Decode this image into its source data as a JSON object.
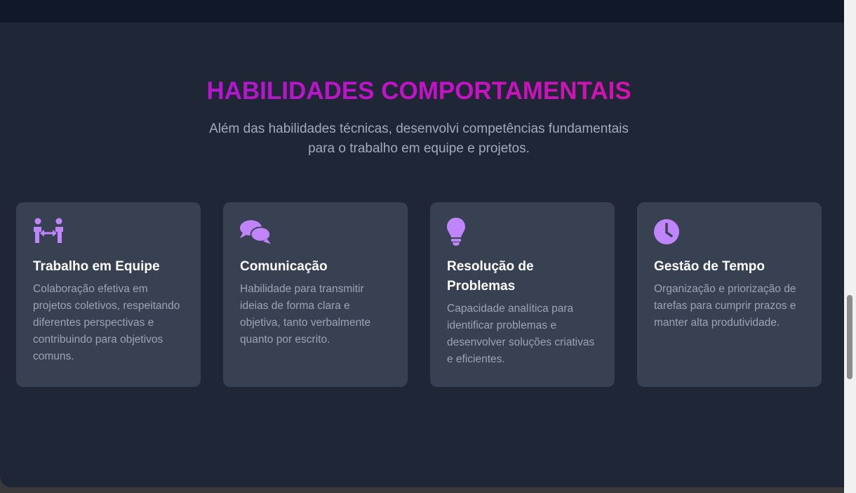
{
  "section": {
    "title": "HABILIDADES COMPORTAMENTAIS",
    "subtitle": "Além das habilidades técnicas, desenvolvi competências fundamentais para o trabalho em equipe e projetos."
  },
  "cards": [
    {
      "icon": "people-arrows-icon",
      "title": "Trabalho em Equipe",
      "description": "Colaboração efetiva em projetos coletivos, respeitando diferentes perspectivas e contribuindo para objetivos comuns."
    },
    {
      "icon": "comments-icon",
      "title": "Comunicação",
      "description": "Habilidade para transmitir ideias de forma clara e objetiva, tanto verbalmente quanto por escrito."
    },
    {
      "icon": "lightbulb-icon",
      "title": "Resolução de Problemas",
      "description": "Capacidade analítica para identificar problemas e desenvolver soluções criativas e eficientes."
    },
    {
      "icon": "clock-icon",
      "title": "Gestão de Tempo",
      "description": "Organização e priorização de tarefas para cumprir prazos e manter alta produtividade."
    }
  ],
  "colors": {
    "background": "#1f2737",
    "header_band": "#111827",
    "card": "#384152",
    "icon": "#c084fc",
    "title_gradient_start": "#a31bd6",
    "title_gradient_end": "#df1590",
    "subtitle_text": "#a2abb8",
    "card_text": "#9ba4b1"
  }
}
